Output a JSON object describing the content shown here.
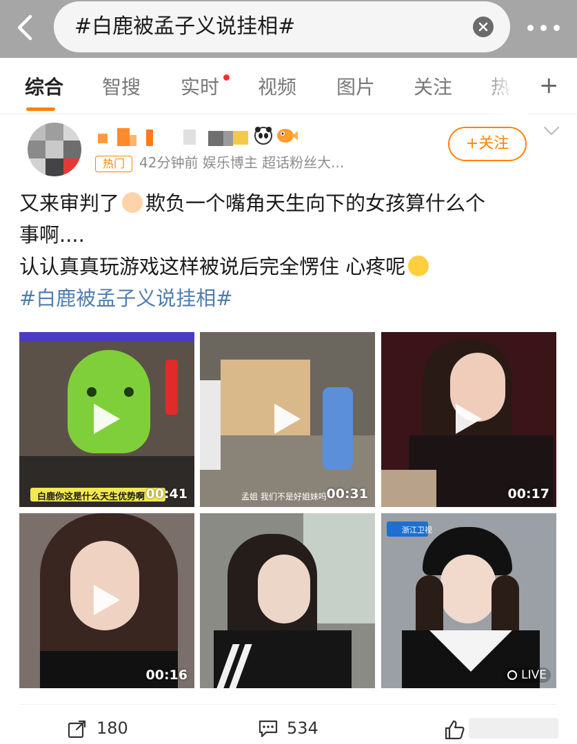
{
  "search": {
    "query": "#白鹿被孟子义说挂相#"
  },
  "tabs": [
    {
      "label": "综合",
      "active": true
    },
    {
      "label": "智搜"
    },
    {
      "label": "实时",
      "has_dot": true
    },
    {
      "label": "视频"
    },
    {
      "label": "图片"
    },
    {
      "label": "关注"
    },
    {
      "label": "热"
    }
  ],
  "post": {
    "badge": "热门",
    "meta": "42分钟前  娱乐博主 超话粉丝大...",
    "follow_label": "+关注",
    "text_line1": "又来审判了",
    "text_line1b": "欺负一个嘴角天生向下的女孩算什么个",
    "text_line2": "事啊....",
    "text_line3": "认认真真玩游戏这样被说后完全愣住 心疼呢",
    "hashtag": "#白鹿被孟子义说挂相#",
    "videos": [
      {
        "duration": "00:41",
        "caption": "白鹿你这是什么天生优势啊"
      },
      {
        "duration": "00:31",
        "caption": "孟姐 我们不是好姐妹吗"
      },
      {
        "duration": "00:17"
      },
      {
        "duration": "00:16"
      },
      {
        "duration": ""
      },
      {
        "duration": "",
        "live_label": "LIVE",
        "caption": "浙江卫视"
      }
    ]
  },
  "actions": {
    "repost_count": "180",
    "comment_count": "534"
  },
  "colors": {
    "accent": "#ff8200",
    "hashtag": "#507daf",
    "topbar": "#a6a6a6"
  }
}
